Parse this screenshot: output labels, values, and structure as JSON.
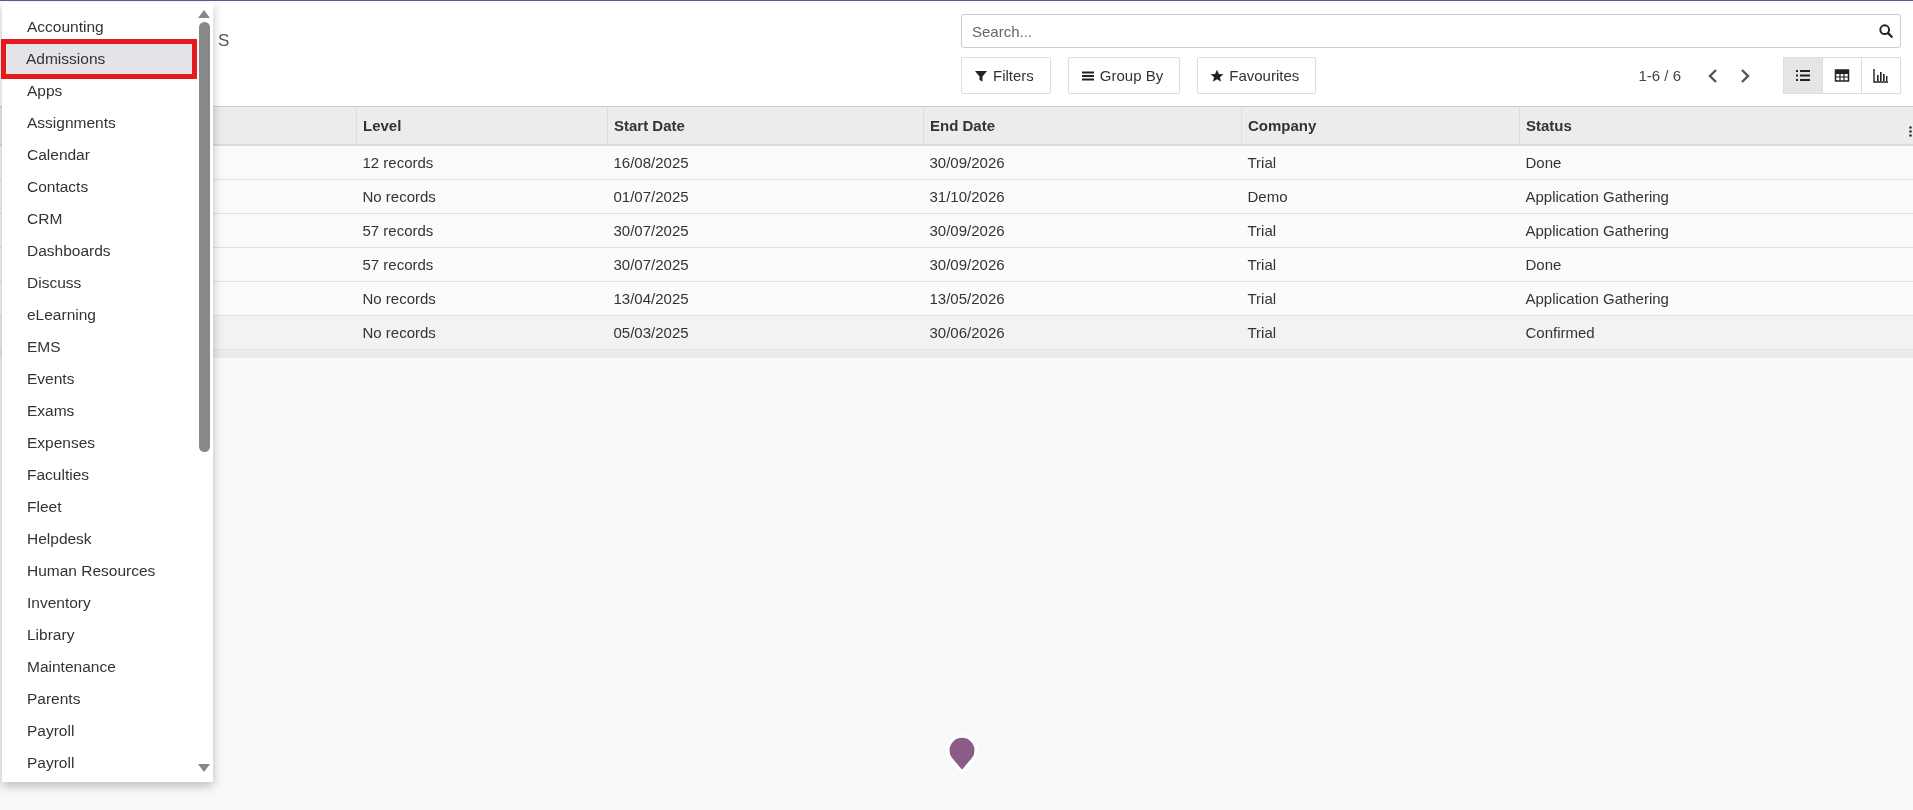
{
  "breadcrumb": "S",
  "search": {
    "placeholder": "Search..."
  },
  "filter_buttons": [
    {
      "label": "Filters",
      "kind": "filter"
    },
    {
      "label": "Group By",
      "kind": "group"
    },
    {
      "label": "Favourites",
      "kind": "star"
    }
  ],
  "pager": "1-6 / 6",
  "view_switcher": [
    {
      "kind": "list",
      "selected": true
    },
    {
      "kind": "grid",
      "selected": false
    },
    {
      "kind": "graph",
      "selected": false
    }
  ],
  "table": {
    "columns": [
      "",
      "Level",
      "Start Date",
      "End Date",
      "Company",
      "Status"
    ],
    "rows": [
      {
        "cells": [
          "",
          "12 records",
          "16/08/2025",
          "30/09/2026",
          "Trial",
          "Done"
        ]
      },
      {
        "cells": [
          "",
          "No records",
          "01/07/2025",
          "31/10/2026",
          "Demo",
          "Application Gathering"
        ]
      },
      {
        "cells": [
          "",
          "57 records",
          "30/07/2025",
          "30/09/2026",
          "Trial",
          "Application Gathering"
        ]
      },
      {
        "cells": [
          "",
          "57 records",
          "30/07/2025",
          "30/09/2026",
          "Trial",
          "Done"
        ]
      },
      {
        "cells": [
          "",
          "No records",
          "13/04/2025",
          "13/05/2026",
          "Trial",
          "Application Gathering"
        ]
      },
      {
        "cells": [
          "",
          "No records",
          "05/03/2025",
          "30/06/2026",
          "Trial",
          "Confirmed"
        ]
      }
    ]
  },
  "app_menu": {
    "items": [
      {
        "label": "Accounting",
        "selected": false
      },
      {
        "label": "Admissions",
        "selected": true
      },
      {
        "label": "Apps",
        "selected": false
      },
      {
        "label": "Assignments",
        "selected": false
      },
      {
        "label": "Calendar",
        "selected": false
      },
      {
        "label": "Contacts",
        "selected": false
      },
      {
        "label": "CRM",
        "selected": false
      },
      {
        "label": "Dashboards",
        "selected": false
      },
      {
        "label": "Discuss",
        "selected": false
      },
      {
        "label": "eLearning",
        "selected": false
      },
      {
        "label": "EMS",
        "selected": false
      },
      {
        "label": "Events",
        "selected": false
      },
      {
        "label": "Exams",
        "selected": false
      },
      {
        "label": "Expenses",
        "selected": false
      },
      {
        "label": "Faculties",
        "selected": false
      },
      {
        "label": "Fleet",
        "selected": false
      },
      {
        "label": "Helpdesk",
        "selected": false
      },
      {
        "label": "Human Resources",
        "selected": false
      },
      {
        "label": "Inventory",
        "selected": false
      },
      {
        "label": "Library",
        "selected": false
      },
      {
        "label": "Maintenance",
        "selected": false
      },
      {
        "label": "Parents",
        "selected": false
      },
      {
        "label": "Payroll",
        "selected": false
      },
      {
        "label": "Payroll",
        "selected": false
      }
    ]
  }
}
